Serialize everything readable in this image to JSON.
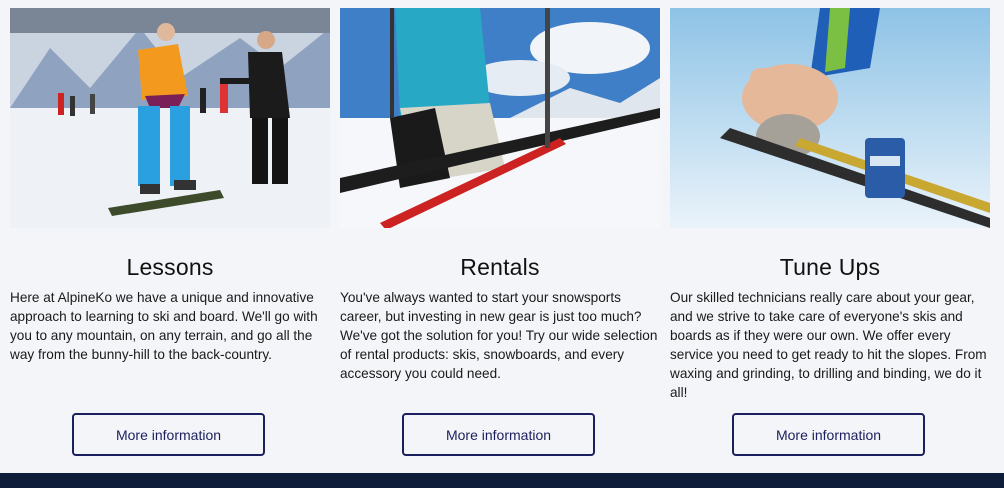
{
  "cards": [
    {
      "title": "Lessons",
      "description": "Here at AlpineKo we have a unique and innovative approach to learning to ski and board. We'll go with you to any mountain, on any terrain, and go all the way from the bunny-hill to the back-country.",
      "button_label": "More information"
    },
    {
      "title": "Rentals",
      "description": "You've always wanted to start your snowsports career, but investing in new gear is just too much? We've got the solution for you! Try our wide selection of rental products: skis, snowboards, and every accessory you could need.",
      "button_label": "More information"
    },
    {
      "title": "Tune Ups",
      "description": "Our skilled technicians really care about your gear, and we strive to take care of everyone's skis and boards as if they were our own. We offer every service you need to get ready to hit the slopes. From waxing and grinding, to drilling and binding, we do it all!",
      "button_label": "More information"
    }
  ],
  "colors": {
    "page_background": "#f4f5f8",
    "button_border": "#1b1f5e",
    "footer": "#0e1e3a"
  }
}
